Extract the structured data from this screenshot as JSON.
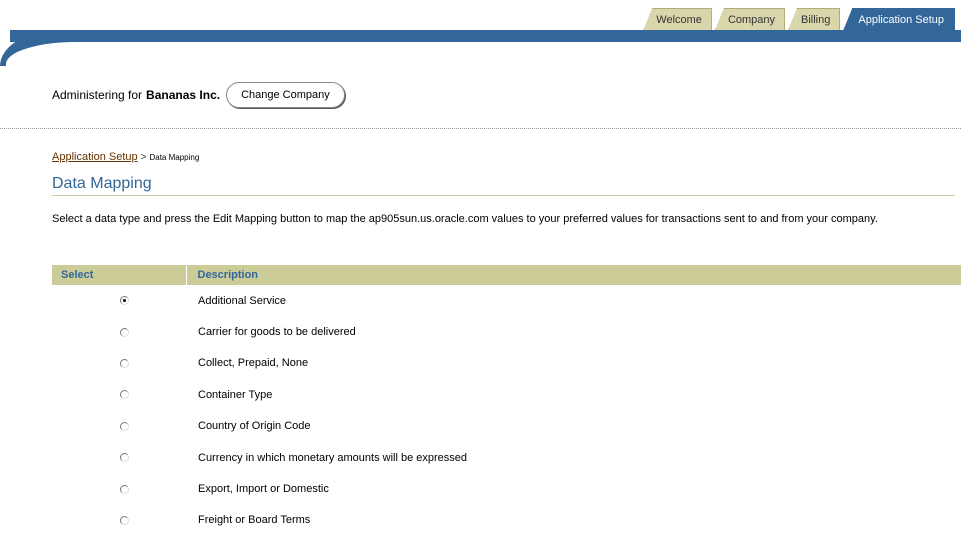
{
  "tabs": [
    {
      "label": "Welcome",
      "active": false
    },
    {
      "label": "Company",
      "active": false
    },
    {
      "label": "Billing",
      "active": false
    },
    {
      "label": "Application Setup",
      "active": true
    }
  ],
  "admin": {
    "prefix": "Administering for",
    "company": "Bananas Inc.",
    "button": "Change Company"
  },
  "breadcrumb": {
    "link": "Application Setup",
    "separator": ">",
    "current": "Data Mapping"
  },
  "page_title": "Data Mapping",
  "instructions": "Select a data type and press the Edit Mapping button to map the ap905sun.us.oracle.com values to your preferred values for transactions sent to and from your company.",
  "table": {
    "headers": {
      "select": "Select",
      "description": "Description"
    },
    "rows": [
      {
        "description": "Additional Service",
        "selected": true
      },
      {
        "description": "Carrier for goods to be delivered",
        "selected": false
      },
      {
        "description": "Collect, Prepaid, None",
        "selected": false
      },
      {
        "description": "Container Type",
        "selected": false
      },
      {
        "description": "Country of Origin Code",
        "selected": false
      },
      {
        "description": "Currency in which monetary amounts will be expressed",
        "selected": false
      },
      {
        "description": "Export, Import or Domestic",
        "selected": false
      },
      {
        "description": "Freight or Board Terms",
        "selected": false
      }
    ]
  },
  "colors": {
    "brand_blue": "#336699",
    "header_tan": "#cccc99",
    "link_brown": "#663300"
  }
}
